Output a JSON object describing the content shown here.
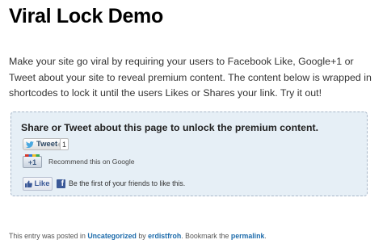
{
  "page": {
    "title": "Viral Lock Demo",
    "intro": "Make your site go viral by requiring your users to Facebook Like, Google+1 or Tweet about your site to reveal premium content. The content below is wrapped in shortcodes to lock it until the users Likes or Shares your link. Try it out!"
  },
  "lock_box": {
    "heading": "Share or Tweet about this page to unlock the premium content.",
    "tweet": {
      "label": "Tweet",
      "count": "1",
      "icon": "twitter-bird-icon"
    },
    "google": {
      "label": "+1",
      "text": "Recommend this on Google"
    },
    "facebook": {
      "label": "Like",
      "icon": "facebook-icon",
      "icon_text": "f",
      "text": "Be the first of your friends to like this."
    }
  },
  "footer": {
    "prefix": "This entry was posted in",
    "category": "Uncategorized",
    "by": "by",
    "author": "erdistfroh",
    "mid": ". Bookmark the",
    "permalink": "permalink",
    "suffix": "."
  },
  "colors": {
    "link": "#1b6aaa",
    "lock_box_bg": "#e6eff6",
    "facebook_blue": "#3b5998"
  }
}
